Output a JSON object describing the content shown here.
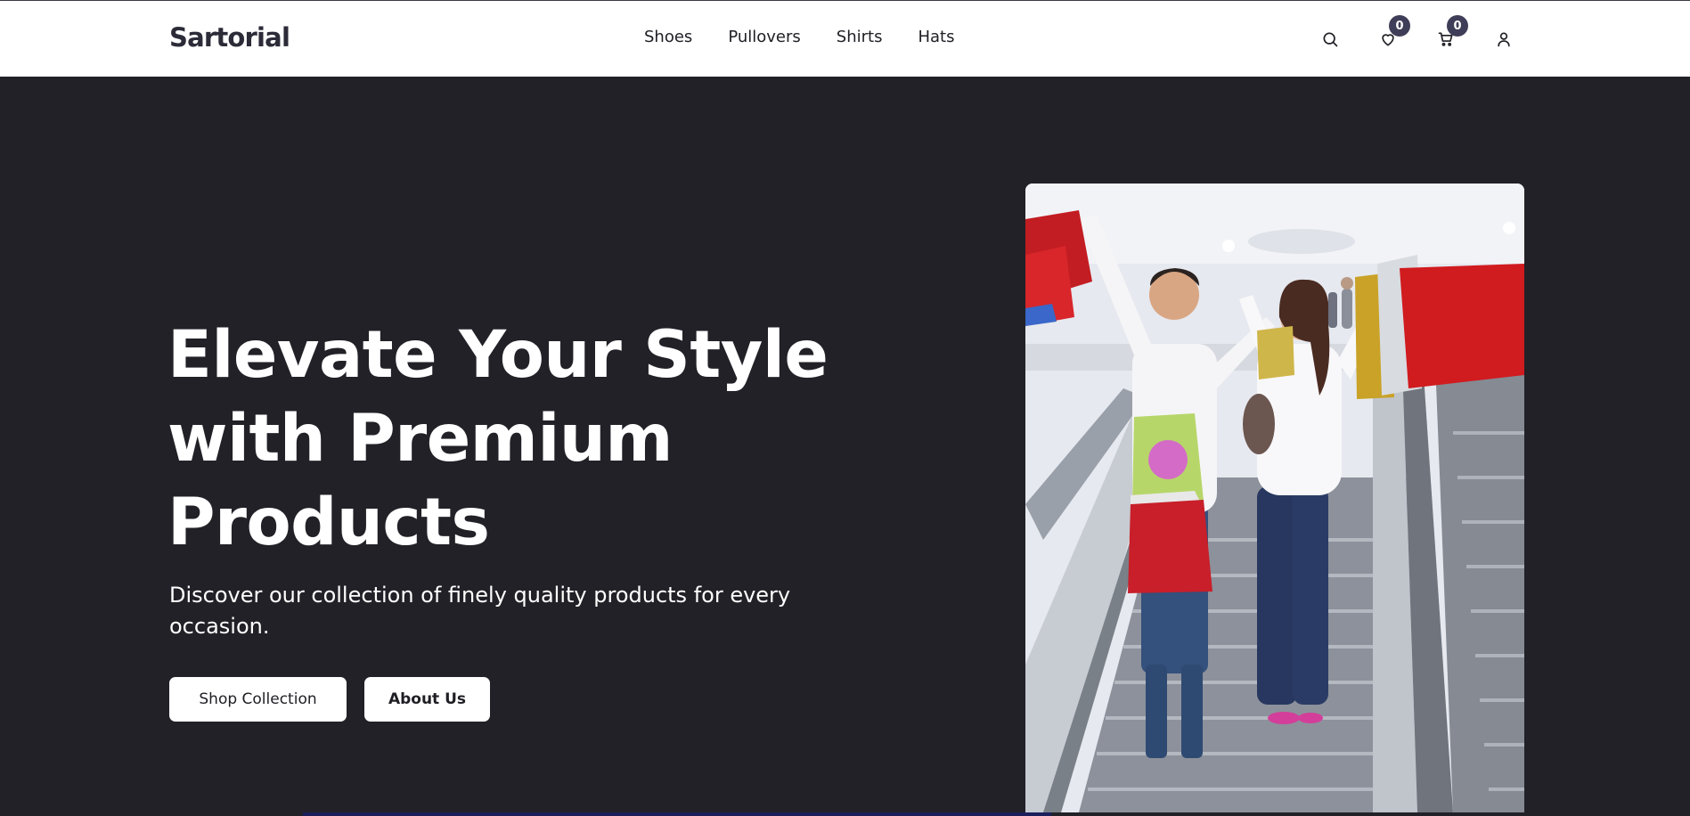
{
  "header": {
    "logo": "Sartorial",
    "nav": [
      {
        "label": "Shoes"
      },
      {
        "label": "Pullovers"
      },
      {
        "label": "Shirts"
      },
      {
        "label": "Hats"
      }
    ],
    "icons": {
      "search": "search-icon",
      "wishlist": "heart-icon",
      "cart": "cart-icon",
      "account": "user-icon"
    },
    "wishlist_count": "0",
    "cart_count": "0"
  },
  "hero": {
    "title": "Elevate Your Style with Premium Products",
    "subtitle": "Discover our collection of finely quality products for every occasion.",
    "primary_button": "Shop Collection",
    "secondary_button": "About Us",
    "image_subject": "couple-with-shopping-bags-on-escalator"
  },
  "colors": {
    "background": "#222127",
    "header_bg": "#ffffff",
    "badge": "#3f3e58",
    "button_bg": "#ffffff",
    "text_light": "#ffffff"
  }
}
